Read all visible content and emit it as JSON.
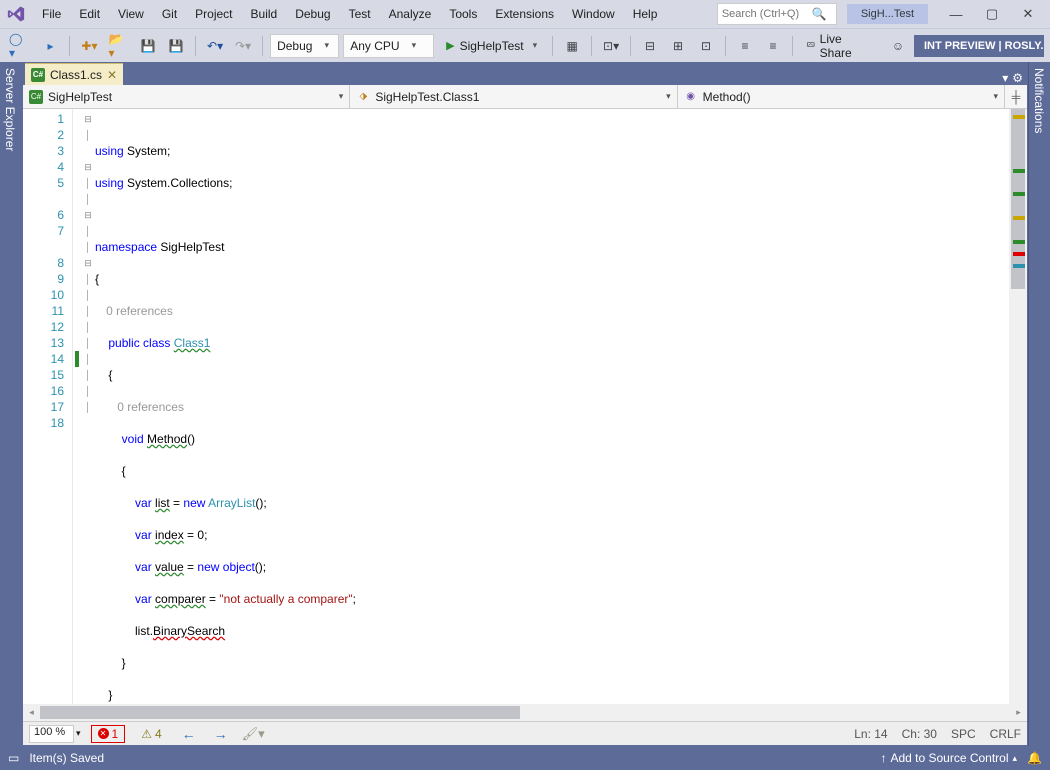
{
  "menu": {
    "items": [
      "File",
      "Edit",
      "View",
      "Git",
      "Project",
      "Build",
      "Debug",
      "Test",
      "Analyze",
      "Tools",
      "Extensions",
      "Window",
      "Help"
    ]
  },
  "search": {
    "placeholder": "Search (Ctrl+Q)"
  },
  "title": "SigH...Test",
  "toolbar": {
    "config": "Debug",
    "platform": "Any CPU",
    "start": "SigHelpTest",
    "liveshare": "Live Share",
    "preview": "INT PREVIEW | ROSLY..."
  },
  "tab": {
    "filename": "Class1.cs"
  },
  "nav": {
    "project": "SigHelpTest",
    "class": "SigHelpTest.Class1",
    "member": "Method()"
  },
  "code": {
    "lines": [
      {
        "n": 1
      },
      {
        "n": 2
      },
      {
        "n": 3
      },
      {
        "n": 4
      },
      {
        "n": 5
      },
      {
        "n": 6
      },
      {
        "n": 7
      },
      {
        "n": 8
      },
      {
        "n": 9
      },
      {
        "n": 10
      },
      {
        "n": 11
      },
      {
        "n": 12
      },
      {
        "n": 13
      },
      {
        "n": 14
      },
      {
        "n": 15
      },
      {
        "n": 16
      },
      {
        "n": 17
      },
      {
        "n": 18
      }
    ],
    "l1_using": "using",
    "l1_sys": "System",
    "l2_using": "using",
    "l2_nsp": "System.Collections",
    "l4_ns": "namespace",
    "l4_name": "SigHelpTest",
    "codelens": "0 references",
    "l6_pub": "public",
    "l6_cls": "class",
    "l6_name": "Class1",
    "l8_void": "void",
    "l8_name": "Method",
    "l10_var": "var",
    "l10_list": "list",
    "l10_new": "new",
    "l10_type": "ArrayList",
    "l11_var": "var",
    "l11_index": "index",
    "l11_val": "0",
    "l12_var": "var",
    "l12_value": "value",
    "l12_new": "new",
    "l12_obj": "object",
    "l13_var": "var",
    "l13_comp": "comparer",
    "l13_str": "\"not actually a comparer\"",
    "l14_list": "list",
    "l14_bs": "BinarySearch"
  },
  "bottom": {
    "zoom": "100 %",
    "errors": "1",
    "warnings": "4",
    "ln": "Ln: 14",
    "ch": "Ch: 30",
    "spc": "SPC",
    "crlf": "CRLF"
  },
  "status": {
    "saved": "Item(s) Saved",
    "source": "Add to Source Control"
  }
}
